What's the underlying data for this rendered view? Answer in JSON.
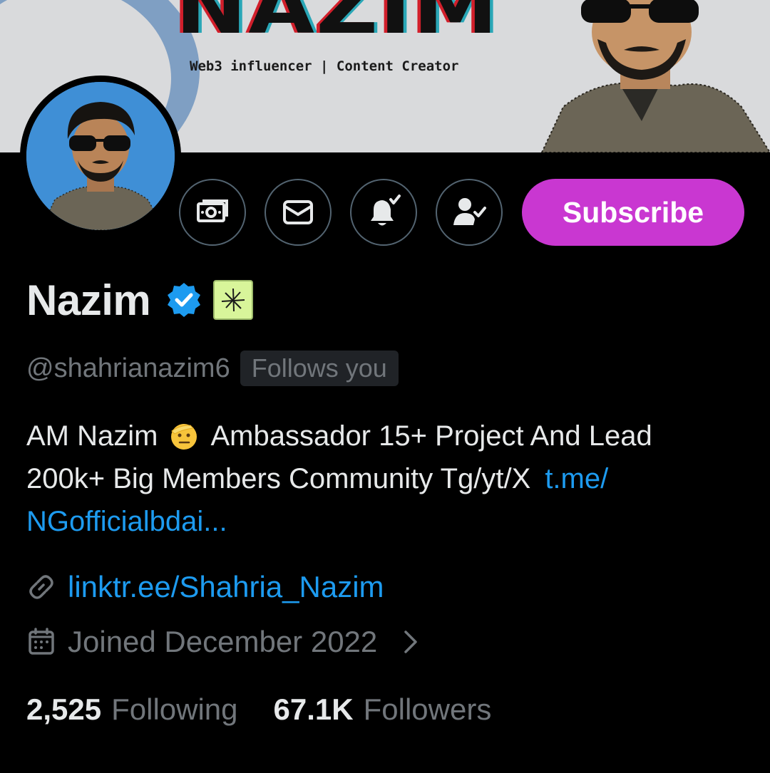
{
  "banner": {
    "title": "NAZIM",
    "tagline": "Web3 influencer | Content Creator"
  },
  "profile": {
    "display_name": "Nazim",
    "handle": "@shahrianazim6",
    "follows_you": "Follows you",
    "bio_line1_before": "AM Nazim",
    "bio_line1_after": "Ambassador 15+ Project And Lead",
    "bio_line2_text": "200k+ Big Members Community Tg/yt/X",
    "bio_line2_link": "t.me/",
    "bio_line3_link": "NGofficialbdai...",
    "website": "linktr.ee/Shahria_Nazim",
    "joined": "Joined December 2022",
    "following_count": "2,525",
    "following_label": "Following",
    "followers_count": "67.1K",
    "followers_label": "Followers"
  },
  "actions": {
    "subscribe_label": "Subscribe"
  },
  "icons": {
    "tip": "money-icon",
    "message": "envelope-icon",
    "notifications": "bell-check-icon",
    "following": "person-check-icon",
    "verified": "verified-badge-icon",
    "link": "link-icon",
    "calendar": "calendar-icon"
  },
  "colors": {
    "subscribe": "#c937d1",
    "link": "#1d9bf0",
    "muted": "#71767b",
    "verified": "#1d9bf0"
  }
}
